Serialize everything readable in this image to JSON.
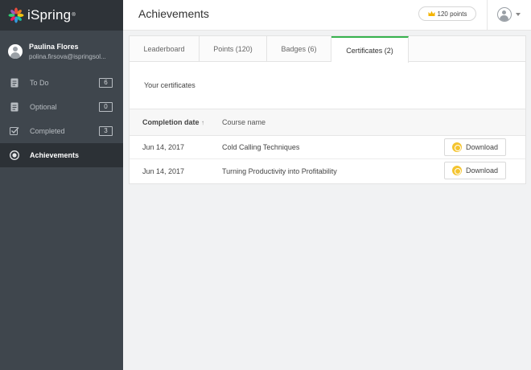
{
  "app": {
    "name": "iSpring",
    "reg_mark": "®"
  },
  "user": {
    "name": "Paulina Flores",
    "email": "polina.firsova@ispringsol..."
  },
  "sidebar": {
    "items": [
      {
        "label": "To Do",
        "count": "6",
        "icon": "document-icon"
      },
      {
        "label": "Optional",
        "count": "0",
        "icon": "document-icon"
      },
      {
        "label": "Completed",
        "count": "3",
        "icon": "checkbox-icon"
      },
      {
        "label": "Achievements",
        "icon": "badge-icon",
        "active": true
      }
    ]
  },
  "header": {
    "title": "Achievements",
    "points": "120 points"
  },
  "tabs": [
    {
      "label": "Leaderboard"
    },
    {
      "label": "Points (120)"
    },
    {
      "label": "Badges (6)"
    },
    {
      "label": "Certificates (2)",
      "active": true
    }
  ],
  "certificates": {
    "section_title": "Your certificates",
    "columns": {
      "date": "Completion date",
      "sort_indicator": "↑",
      "course": "Course name"
    },
    "rows": [
      {
        "date": "Jun 14, 2017",
        "course": "Cold Calling Techniques",
        "action": "Download"
      },
      {
        "date": "Jun 14, 2017",
        "course": "Turning Productivity into Profitability",
        "action": "Download"
      }
    ]
  },
  "colors": {
    "accent": "#37b24d",
    "sidebar_bg": "#3f464d",
    "medal": "#f4c430"
  }
}
